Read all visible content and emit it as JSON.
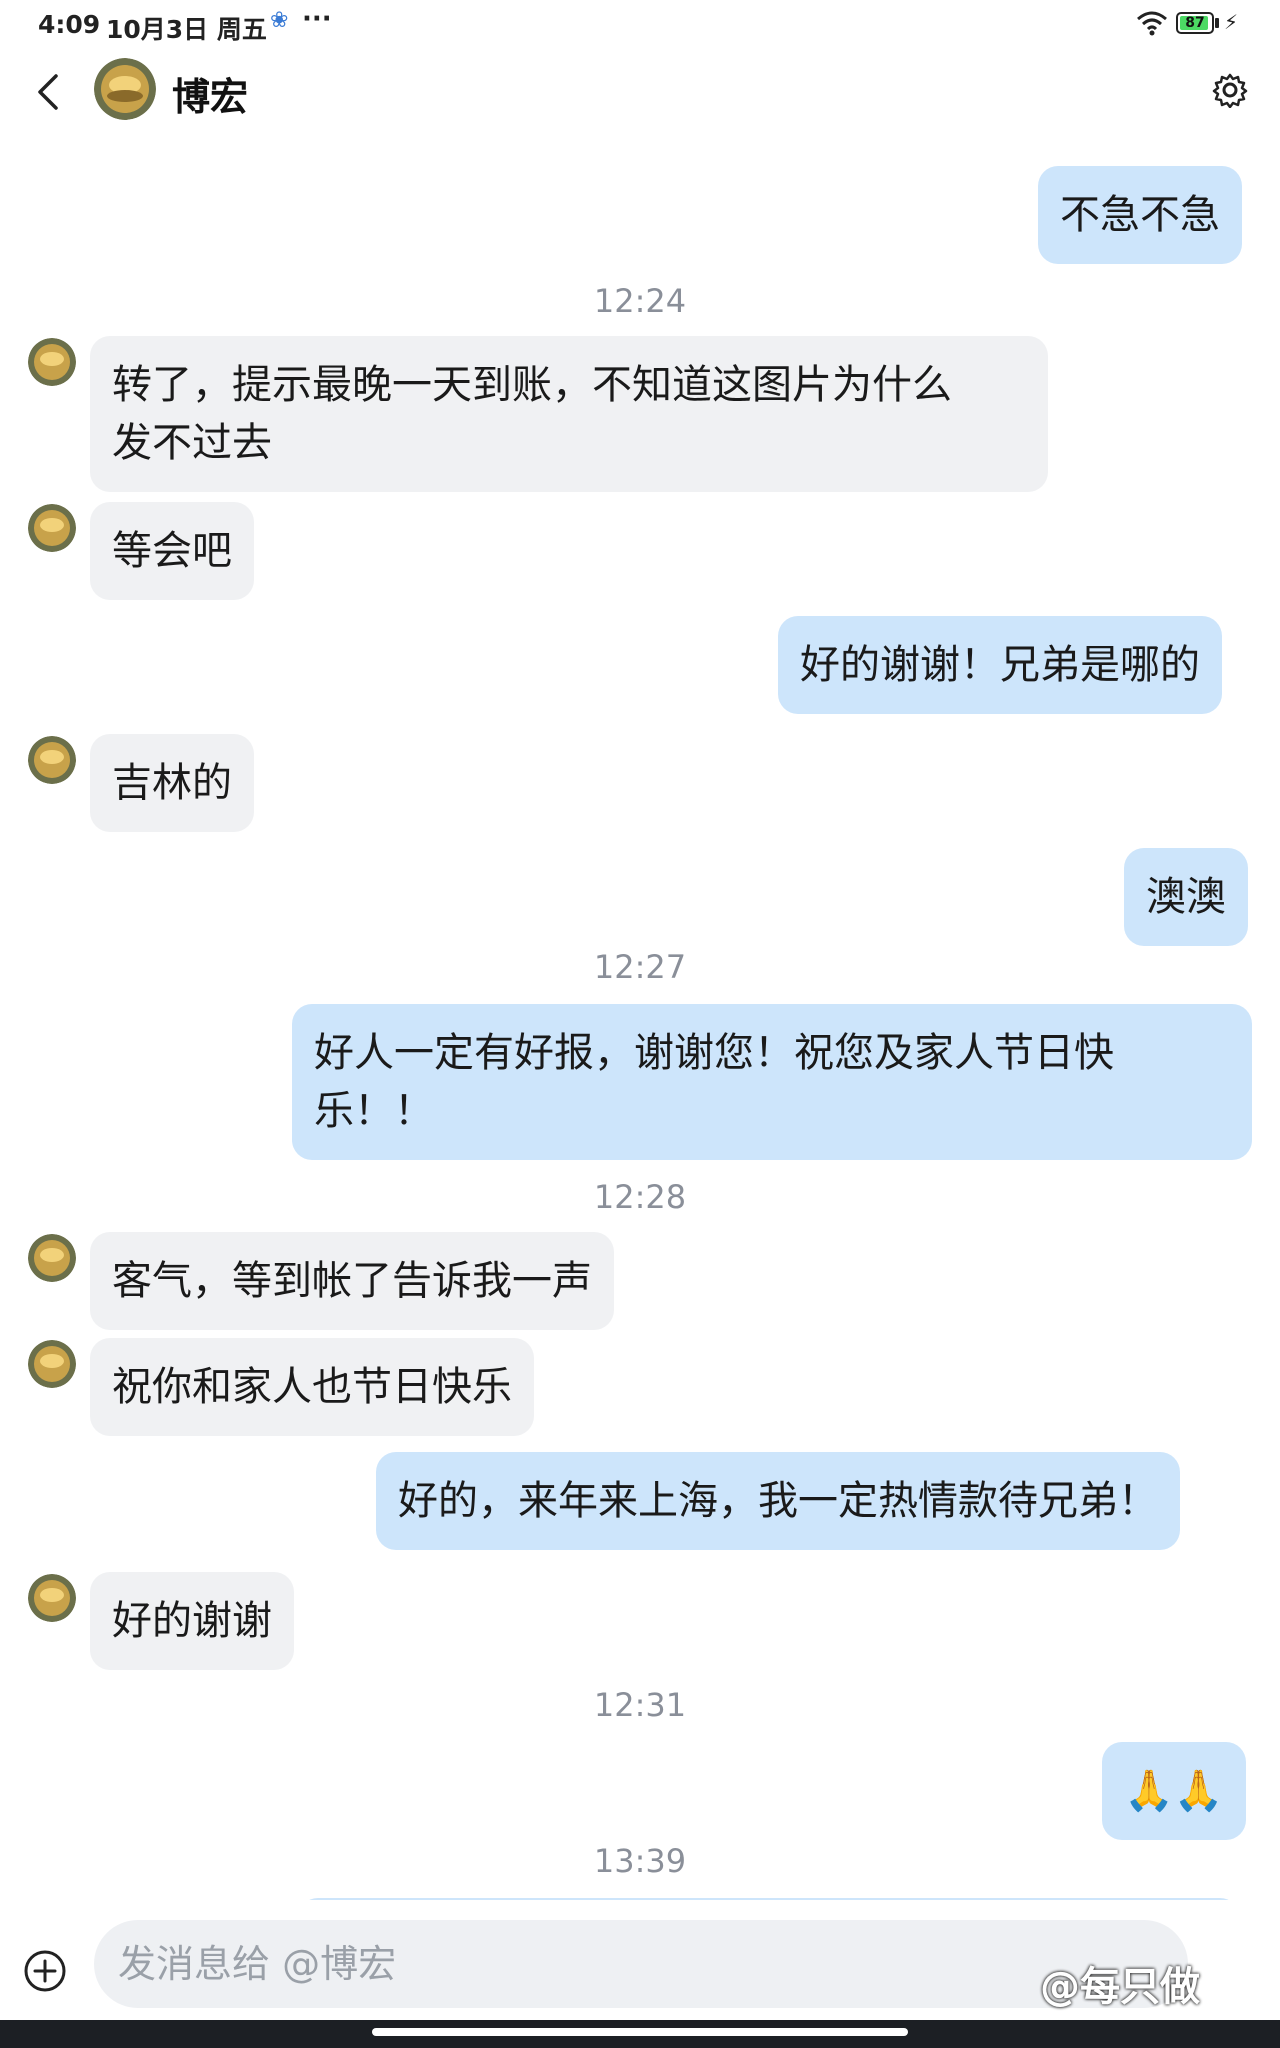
{
  "status_bar": {
    "time": "4:09",
    "date": "10月3日 周五",
    "more": "···",
    "battery_level": "87",
    "accent": "#4cd964"
  },
  "header": {
    "title": "博宏",
    "back_icon": "chevron-left-icon",
    "settings_icon": "gear-icon"
  },
  "chat": {
    "colors": {
      "incoming": "#f0f1f3",
      "outgoing": "#cde5fb",
      "timestamp": "#8a8f99"
    },
    "messages": [
      {
        "type": "out",
        "text": "不急不急"
      },
      {
        "type": "time",
        "text": "12:24"
      },
      {
        "type": "in",
        "text": "转了，提示最晚一天到账，不知道这图片为什么\n发不过去"
      },
      {
        "type": "in",
        "text": "等会吧"
      },
      {
        "type": "out",
        "text": "好的谢谢！兄弟是哪的"
      },
      {
        "type": "in",
        "text": "吉林的"
      },
      {
        "type": "out",
        "text": "澳澳"
      },
      {
        "type": "time",
        "text": "12:27"
      },
      {
        "type": "out",
        "text": "好人一定有好报，谢谢您！祝您及家人节日快\n乐！！"
      },
      {
        "type": "time",
        "text": "12:28"
      },
      {
        "type": "in",
        "text": "客气，等到帐了告诉我一声"
      },
      {
        "type": "in",
        "text": "祝你和家人也节日快乐"
      },
      {
        "type": "out",
        "text": "好的，来年来上海，我一定热情款待兄弟！"
      },
      {
        "type": "in",
        "text": "好的谢谢"
      },
      {
        "type": "time",
        "text": "12:31"
      },
      {
        "type": "out",
        "text": "🙏🙏"
      },
      {
        "type": "time",
        "text": "13:39"
      }
    ]
  },
  "input": {
    "placeholder": "发消息给 @博宏",
    "plus_icon": "plus-circle-icon"
  },
  "watermark": "@每只做"
}
